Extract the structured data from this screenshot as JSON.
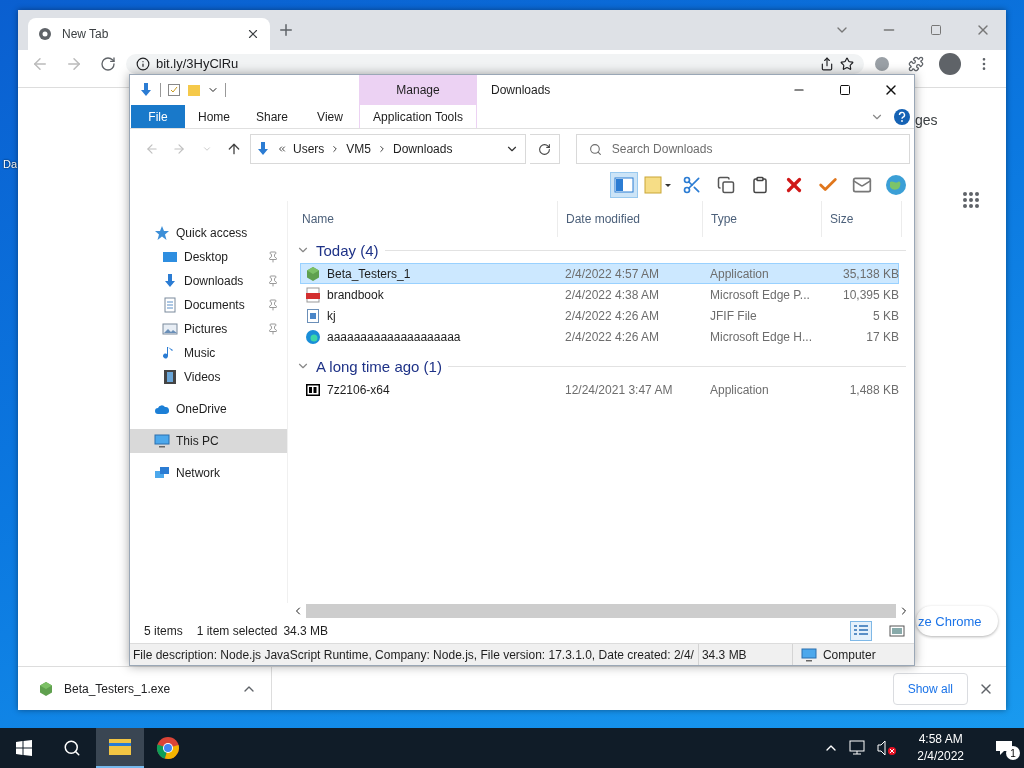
{
  "desktop": {
    "icon_labels": [
      "Da"
    ]
  },
  "browser": {
    "tabs": [
      {
        "title": "New Tab",
        "selected": true
      }
    ],
    "address": "bit.ly/3HyClRu",
    "page_text": "ges",
    "customize_button": "ze Chrome",
    "download_shelf": {
      "file": "Beta_Testers_1.exe",
      "show_all": "Show all"
    }
  },
  "explorer": {
    "title": "Downloads",
    "context_tab": "Manage",
    "ribbon_tabs": [
      {
        "label": "File",
        "kind": "file"
      },
      {
        "label": "Home",
        "kind": "plain"
      },
      {
        "label": "Share",
        "kind": "plain"
      },
      {
        "label": "View",
        "kind": "plain"
      },
      {
        "label": "Application Tools",
        "kind": "context"
      }
    ],
    "breadcrumbs": [
      "Users",
      "VM5",
      "Downloads"
    ],
    "search": {
      "placeholder": "Search Downloads"
    },
    "nav": [
      {
        "label": "Quick access",
        "kind": "quick-access",
        "selected": false,
        "children": [
          {
            "label": "Desktop",
            "kind": "desktop",
            "pinned": true,
            "selected": false
          },
          {
            "label": "Downloads",
            "kind": "downloads",
            "pinned": true,
            "selected": false
          },
          {
            "label": "Documents",
            "kind": "documents",
            "pinned": true,
            "selected": false
          },
          {
            "label": "Pictures",
            "kind": "pictures",
            "pinned": true,
            "selected": false
          },
          {
            "label": "Music",
            "kind": "music",
            "pinned": false,
            "selected": false
          },
          {
            "label": "Videos",
            "kind": "videos",
            "pinned": false,
            "selected": false
          }
        ]
      },
      {
        "label": "OneDrive",
        "kind": "onedrive",
        "selected": false
      },
      {
        "label": "This PC",
        "kind": "this-pc",
        "selected": true
      },
      {
        "label": "Network",
        "kind": "network",
        "selected": false
      }
    ],
    "columns": [
      "Name",
      "Date modified",
      "Type",
      "Size"
    ],
    "groups": [
      {
        "label": "Today (4)",
        "expanded": true,
        "items": [
          {
            "name": "Beta_Testers_1",
            "date": "2/4/2022 4:57 AM",
            "type": "Application",
            "size": "35,138 KB",
            "kind": "node",
            "selected": true
          },
          {
            "name": "brandbook",
            "date": "2/4/2022 4:38 AM",
            "type": "Microsoft Edge P...",
            "size": "10,395 KB",
            "kind": "pdf",
            "selected": false
          },
          {
            "name": "kj",
            "date": "2/4/2022 4:26 AM",
            "type": "JFIF File",
            "size": "5 KB",
            "kind": "image",
            "selected": false
          },
          {
            "name": "aaaaaaaaaaaaaaaaaaaa",
            "date": "2/4/2022 4:26 AM",
            "type": "Microsoft Edge H...",
            "size": "17 KB",
            "kind": "edge",
            "selected": false
          }
        ]
      },
      {
        "label": "A long time ago (1)",
        "expanded": true,
        "items": [
          {
            "name": "7z2106-x64",
            "date": "12/24/2021 3:47 AM",
            "type": "Application",
            "size": "1,488 KB",
            "kind": "archive",
            "selected": false
          }
        ]
      }
    ],
    "status": {
      "count": "5 items",
      "selection": "1 item selected",
      "selection_size": "34.3 MB"
    },
    "details_bar": {
      "description": "File description: Node.js JavaScript Runtime, Company: Node.js, File version: 17.3.1.0, Date created: 2/4/",
      "size": "34.3 MB",
      "location": "Computer"
    }
  },
  "taskbar": {
    "apps": [
      {
        "kind": "explorer",
        "active": true
      },
      {
        "kind": "chrome",
        "active": false
      }
    ],
    "time": "4:58 AM",
    "date": "2/4/2022",
    "notifications": "1"
  }
}
